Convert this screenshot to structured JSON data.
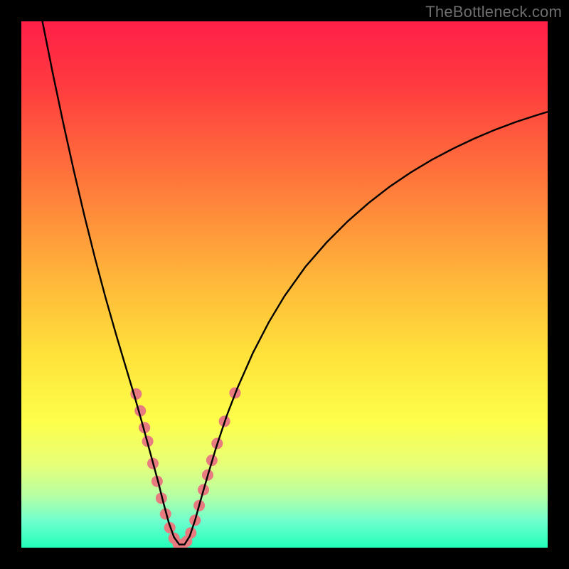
{
  "watermark": {
    "text": "TheBottleneck.com"
  },
  "chart_data": {
    "type": "line",
    "title": "",
    "xlabel": "",
    "ylabel": "",
    "xlim": [
      0,
      100
    ],
    "ylim": [
      0,
      100
    ],
    "gradient_stops": [
      {
        "offset": 0.0,
        "color": "#ff1f48"
      },
      {
        "offset": 0.12,
        "color": "#ff3a3f"
      },
      {
        "offset": 0.3,
        "color": "#ff763b"
      },
      {
        "offset": 0.48,
        "color": "#ffb33a"
      },
      {
        "offset": 0.63,
        "color": "#ffe13a"
      },
      {
        "offset": 0.76,
        "color": "#fdff4a"
      },
      {
        "offset": 0.84,
        "color": "#e8ff76"
      },
      {
        "offset": 0.9,
        "color": "#b8ffa3"
      },
      {
        "offset": 0.95,
        "color": "#6effce"
      },
      {
        "offset": 1.0,
        "color": "#22ffb9"
      }
    ],
    "series": [
      {
        "name": "bottleneck-curve",
        "xy": [
          [
            4.0,
            100.0
          ],
          [
            6.0,
            90.0
          ],
          [
            8.0,
            80.5
          ],
          [
            10.0,
            71.5
          ],
          [
            12.0,
            63.0
          ],
          [
            14.0,
            55.0
          ],
          [
            16.0,
            47.5
          ],
          [
            18.0,
            40.5
          ],
          [
            20.0,
            33.8
          ],
          [
            21.5,
            28.8
          ],
          [
            23.0,
            23.5
          ],
          [
            24.5,
            18.0
          ],
          [
            26.0,
            12.5
          ],
          [
            27.0,
            8.5
          ],
          [
            28.0,
            4.8
          ],
          [
            29.0,
            2.0
          ],
          [
            30.0,
            0.6
          ],
          [
            31.0,
            0.6
          ],
          [
            32.0,
            2.2
          ],
          [
            33.0,
            5.2
          ],
          [
            34.0,
            8.8
          ],
          [
            35.5,
            14.0
          ],
          [
            37.0,
            19.0
          ],
          [
            39.0,
            25.0
          ],
          [
            41.0,
            30.2
          ],
          [
            44.0,
            37.0
          ],
          [
            47.0,
            42.8
          ],
          [
            50.0,
            47.8
          ],
          [
            54.0,
            53.4
          ],
          [
            58.0,
            58.0
          ],
          [
            62.0,
            62.0
          ],
          [
            66.0,
            65.5
          ],
          [
            70.0,
            68.6
          ],
          [
            74.0,
            71.3
          ],
          [
            78.0,
            73.7
          ],
          [
            82.0,
            75.8
          ],
          [
            86.0,
            77.7
          ],
          [
            90.0,
            79.4
          ],
          [
            94.0,
            80.9
          ],
          [
            98.0,
            82.2
          ],
          [
            100.0,
            82.8
          ]
        ]
      }
    ],
    "data_markers": [
      {
        "x": 21.8,
        "y": 29.2
      },
      {
        "x": 22.6,
        "y": 26.0
      },
      {
        "x": 23.4,
        "y": 22.8
      },
      {
        "x": 24.0,
        "y": 20.2
      },
      {
        "x": 25.0,
        "y": 16.0
      },
      {
        "x": 25.8,
        "y": 12.6
      },
      {
        "x": 26.6,
        "y": 9.4
      },
      {
        "x": 27.4,
        "y": 6.4
      },
      {
        "x": 28.2,
        "y": 3.8
      },
      {
        "x": 29.0,
        "y": 1.8
      },
      {
        "x": 29.8,
        "y": 0.7
      },
      {
        "x": 30.6,
        "y": 0.6
      },
      {
        "x": 31.4,
        "y": 1.2
      },
      {
        "x": 32.2,
        "y": 2.8
      },
      {
        "x": 33.0,
        "y": 5.2
      },
      {
        "x": 33.8,
        "y": 8.0
      },
      {
        "x": 34.6,
        "y": 11.0
      },
      {
        "x": 35.4,
        "y": 13.8
      },
      {
        "x": 36.2,
        "y": 16.6
      },
      {
        "x": 37.2,
        "y": 19.8
      },
      {
        "x": 38.6,
        "y": 24.0
      },
      {
        "x": 40.6,
        "y": 29.4
      }
    ],
    "marker_style": {
      "radius_px": 8,
      "fill": "#e77b7f",
      "stroke": "none"
    }
  }
}
